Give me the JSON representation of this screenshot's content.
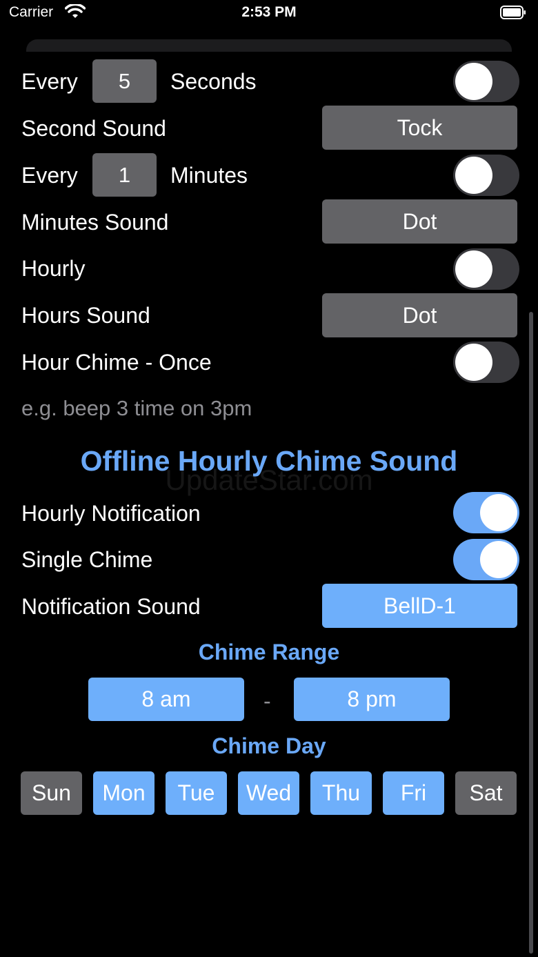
{
  "status_bar": {
    "carrier": "Carrier",
    "time": "2:53 PM"
  },
  "settings": {
    "every_seconds": {
      "prefix": "Every",
      "value": "5",
      "unit": "Seconds",
      "enabled": false
    },
    "second_sound": {
      "label": "Second Sound",
      "value": "Tock"
    },
    "every_minutes": {
      "prefix": "Every",
      "value": "1",
      "unit": "Minutes",
      "enabled": false
    },
    "minutes_sound": {
      "label": "Minutes Sound",
      "value": "Dot"
    },
    "hourly": {
      "label": "Hourly",
      "enabled": false
    },
    "hours_sound": {
      "label": "Hours Sound",
      "value": "Dot"
    },
    "hour_chime_once": {
      "label": "Hour Chime - Once",
      "enabled": false
    },
    "hint": "e.g. beep 3 time on 3pm"
  },
  "offline": {
    "title": "Offline Hourly Chime Sound",
    "watermark": "UpdateStar.com",
    "hourly_notification": {
      "label": "Hourly Notification",
      "enabled": true
    },
    "single_chime": {
      "label": "Single Chime",
      "enabled": true
    },
    "notification_sound": {
      "label": "Notification Sound",
      "value": "BellD-1"
    },
    "chime_range": {
      "title": "Chime Range",
      "start": "8 am",
      "separator": "-",
      "end": "8 pm"
    },
    "chime_day": {
      "title": "Chime Day",
      "days": [
        {
          "label": "Sun",
          "selected": false
        },
        {
          "label": "Mon",
          "selected": true
        },
        {
          "label": "Tue",
          "selected": true
        },
        {
          "label": "Wed",
          "selected": true
        },
        {
          "label": "Thu",
          "selected": true
        },
        {
          "label": "Fri",
          "selected": true
        },
        {
          "label": "Sat",
          "selected": false
        }
      ]
    }
  },
  "colors": {
    "accent": "#6aa8f7",
    "button_gray": "#636366",
    "background": "#000000"
  }
}
